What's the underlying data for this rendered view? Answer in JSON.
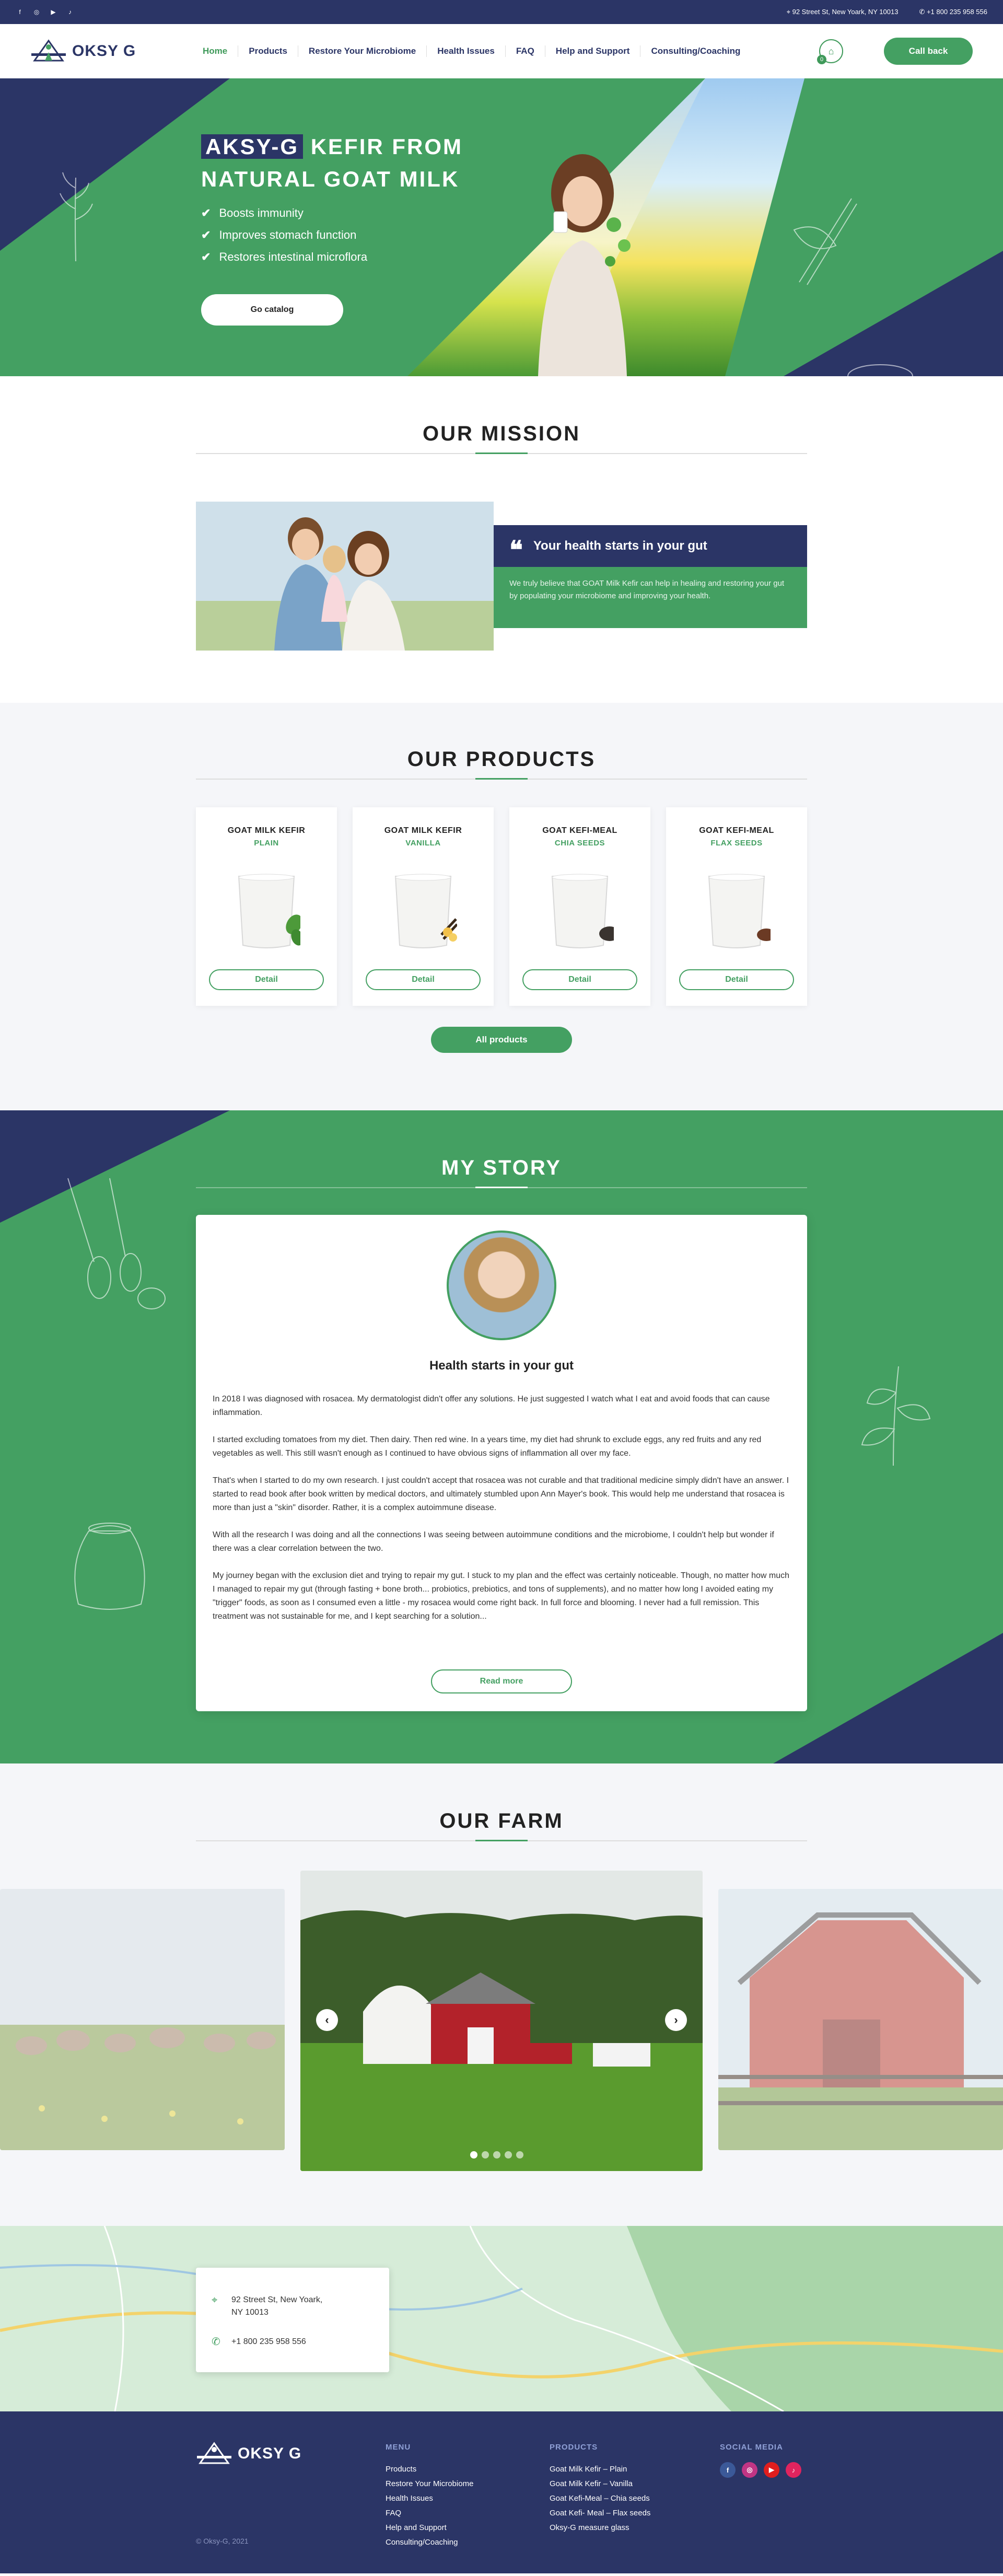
{
  "topbar": {
    "address": "92 Street St, New Yoark, NY 10013",
    "phone": "+1 800 235 958 556"
  },
  "nav": {
    "logo": "OKSY G",
    "items": [
      {
        "label": "Home",
        "active": true
      },
      {
        "label": "Products"
      },
      {
        "label": "Restore Your Microbiome"
      },
      {
        "label": "Health Issues"
      },
      {
        "label": "FAQ"
      },
      {
        "label": "Help and Support"
      },
      {
        "label": "Consulting/Coaching"
      }
    ],
    "cart_count": "0",
    "callback": "Call back"
  },
  "hero": {
    "title_highlight": "AKSY-G",
    "title_rest": "KEFIR FROM",
    "title_line2": "NATURAL GOAT MILK",
    "bullets": [
      "Boosts immunity",
      "Improves stomach function",
      "Restores intestinal microflora"
    ],
    "cta": "Go catalog"
  },
  "mission": {
    "title": "OUR MISSION",
    "quote": "Your health starts in your gut",
    "text": "We truly believe that GOAT Milk Kefir can help in healing and restoring your gut by populating your microbiome and improving your health."
  },
  "products": {
    "title": "OUR PRODUCTS",
    "items": [
      {
        "name": "GOAT MILK KEFIR",
        "variant": "PLAIN",
        "detail": "Detail",
        "garnish": "leaf"
      },
      {
        "name": "GOAT MILK KEFIR",
        "variant": "VANILLA",
        "detail": "Detail",
        "garnish": "vanilla"
      },
      {
        "name": "GOAT KEFI-MEAL",
        "variant": "CHIA SEEDS",
        "detail": "Detail",
        "garnish": "chia"
      },
      {
        "name": "GOAT KEFI-MEAL",
        "variant": "FLAX SEEDS",
        "detail": "Detail",
        "garnish": "flax"
      }
    ],
    "all": "All products"
  },
  "story": {
    "title": "MY STORY",
    "heading": "Health starts in your gut",
    "paragraphs": [
      "In 2018 I was diagnosed with rosacea. My dermatologist didn't offer any solutions. He just suggested I watch what I eat and avoid foods that can cause inflammation.",
      "I started excluding tomatoes from my diet. Then dairy. Then red wine. In a years time, my diet had shrunk to exclude eggs, any red fruits and any red vegetables as well. This still wasn't enough as I continued to have obvious signs of inflammation all over my face.",
      "That's when I started to do my own research. I just couldn't accept that rosacea was not curable and that traditional medicine simply didn't have an answer. I started to read book after book written by medical doctors, and ultimately stumbled upon Ann Mayer's book. This would help me understand that rosacea is more than just a \"skin\" disorder. Rather, it is a complex autoimmune disease.",
      "With all the research I was doing and all the connections I was seeing between autoimmune conditions and the microbiome, I couldn't help but wonder if there was a clear correlation between the two.",
      "My journey began with the exclusion diet and trying to repair my gut. I stuck to my plan and the effect was certainly noticeable. Though, no matter how much I managed to repair my gut (through fasting + bone broth... probiotics, prebiotics, and tons of supplements), and no matter how long I avoided eating my \"trigger\" foods, as soon as I consumed even a little - my rosacea would come right back. In full force and blooming. I never had a full remission. This treatment was not sustainable for me, and I kept searching for a solution..."
    ],
    "read_more": "Read more"
  },
  "farm": {
    "title": "OUR FARM",
    "slides": 5,
    "active_slide": 1
  },
  "map": {
    "address_line1": "92 Street St, New Yoark,",
    "address_line2": "NY 10013",
    "phone": "+1 800 235 958 556"
  },
  "footer": {
    "logo": "OKSY G",
    "copyright": "© Oksy-G, 2021",
    "menu_title": "MENU",
    "menu": [
      "Products",
      "Restore Your Microbiome",
      "Health Issues",
      "FAQ",
      "Help and Support",
      "Consulting/Coaching"
    ],
    "products_title": "PRODUCTS",
    "products": [
      "Goat Milk Kefir – Plain",
      "Goat Milk Kefir – Vanilla",
      "Goat Kefi-Meal – Chia seeds",
      "Goat Kefi- Meal – Flax seeds",
      "Oksy-G measure glass"
    ],
    "social_title": "SOCIAL MEDIA",
    "social": [
      "facebook-icon",
      "instagram-icon",
      "youtube-icon",
      "tiktok-icon"
    ],
    "colors": {
      "navy": "#2b3566",
      "green": "#44a062"
    }
  }
}
